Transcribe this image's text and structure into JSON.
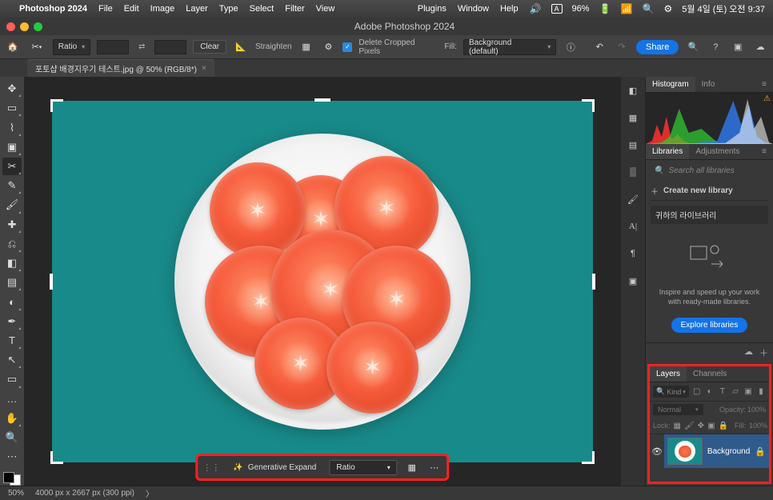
{
  "menubar": {
    "app": "Photoshop 2024",
    "items": [
      "File",
      "Edit",
      "Image",
      "Layer",
      "Type",
      "Select",
      "Filter",
      "View",
      "Plugins",
      "Window",
      "Help"
    ],
    "battery": "96%",
    "clock": "5월 4일 (토) 오전 9:37",
    "lang": "A"
  },
  "window": {
    "title": "Adobe Photoshop 2024"
  },
  "options": {
    "ratio_label": "Ratio",
    "clear": "Clear",
    "straighten": "Straighten",
    "delete_cropped": "Delete Cropped Pixels",
    "fill_label": "Fill:",
    "fill_value": "Background (default)",
    "share": "Share"
  },
  "doc": {
    "tab": "포토샵 배경지우기 테스트.jpg @ 50% (RGB/8*)"
  },
  "ctb": {
    "gen_expand": "Generative Expand",
    "ratio": "Ratio"
  },
  "panels": {
    "histogram_tab": "Histogram",
    "info_tab": "Info",
    "libraries_tab": "Libraries",
    "adjustments_tab": "Adjustments",
    "search_placeholder": "Search all libraries",
    "create_lib": "Create new library",
    "my_lib": "귀하의 라이브러리",
    "inspire": "Inspire and speed up your work with ready-made libraries.",
    "explore": "Explore libraries",
    "layers_tab": "Layers",
    "channels_tab": "Channels",
    "kind": "Kind",
    "blend_mode": "Normal",
    "opacity_label": "Opacity:",
    "opacity_val": "100%",
    "lock_label": "Lock:",
    "fill_label": "Fill:",
    "fill_val": "100%",
    "layer_bg": "Background"
  },
  "status": {
    "zoom": "50%",
    "dims": "4000 px x 2667 px (300 ppi)"
  }
}
